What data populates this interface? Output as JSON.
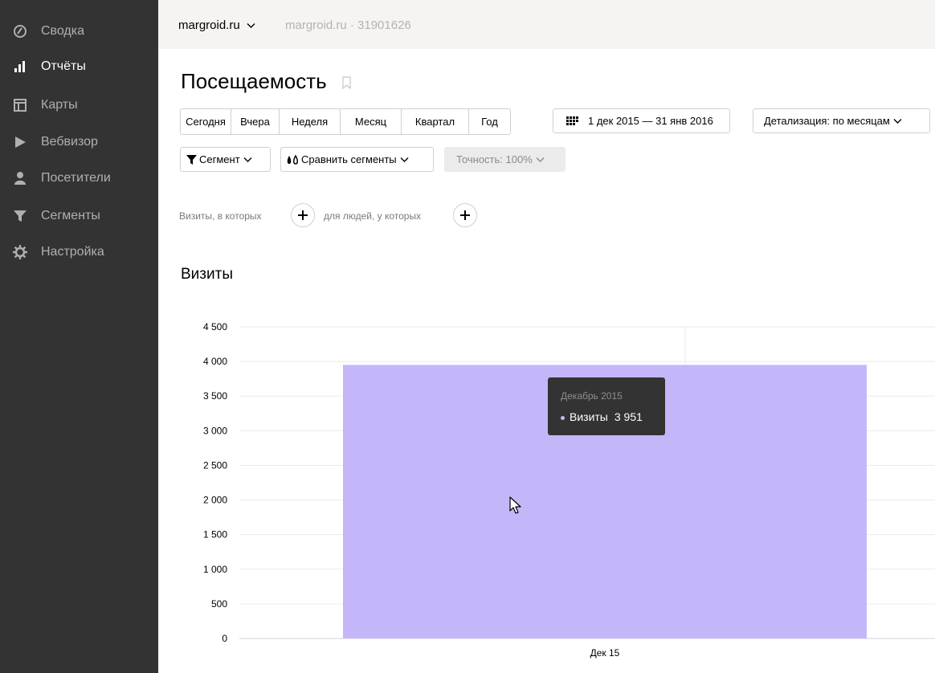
{
  "sidebar": {
    "items": [
      {
        "label": "Сводка",
        "icon": "speedometer-icon"
      },
      {
        "label": "Отчёты",
        "icon": "bar-chart-icon",
        "active": true
      },
      {
        "label": "Карты",
        "icon": "map-grid-icon"
      },
      {
        "label": "Вебвизор",
        "icon": "play-icon"
      },
      {
        "label": "Посетители",
        "icon": "person-icon"
      },
      {
        "label": "Сегменты",
        "icon": "funnel-icon"
      },
      {
        "label": "Настройка",
        "icon": "gear-icon"
      }
    ]
  },
  "header": {
    "site": "margroid.ru",
    "site_sub": "margroid.ru · 31901626"
  },
  "page": {
    "title": "Посещаемость"
  },
  "periods": [
    "Сегодня",
    "Вчера",
    "Неделя",
    "Месяц",
    "Квартал",
    "Год"
  ],
  "date_range": "1 дек 2015 — 31 янв 2016",
  "detail": "Детализация: по месяцам",
  "segment": "Сегмент",
  "compare": "Сравнить сегменты",
  "accuracy": "Точность: 100%",
  "conditions": {
    "visits_label": "Визиты, в которых",
    "people_label": "для людей, у которых"
  },
  "section_title": "Визиты",
  "chart_data": {
    "type": "bar",
    "categories": [
      "Дек 15"
    ],
    "series": [
      {
        "name": "Визиты",
        "values": [
          3951
        ]
      }
    ],
    "ylim": [
      0,
      4500
    ],
    "yticks": [
      "0",
      "500",
      "1 000",
      "1 500",
      "2 000",
      "2 500",
      "3 000",
      "3 500",
      "4 000",
      "4 500"
    ],
    "grid": true,
    "bar_color": "#c5b6fa"
  },
  "tooltip": {
    "title": "Декабрь 2015",
    "series": "Визиты",
    "value": "3 951"
  },
  "colors": {
    "sidebar_bg": "#333333",
    "topbar_bg": "#f5f4f2",
    "bar": "#c5b6fa",
    "tooltip_bg": "#333333"
  }
}
